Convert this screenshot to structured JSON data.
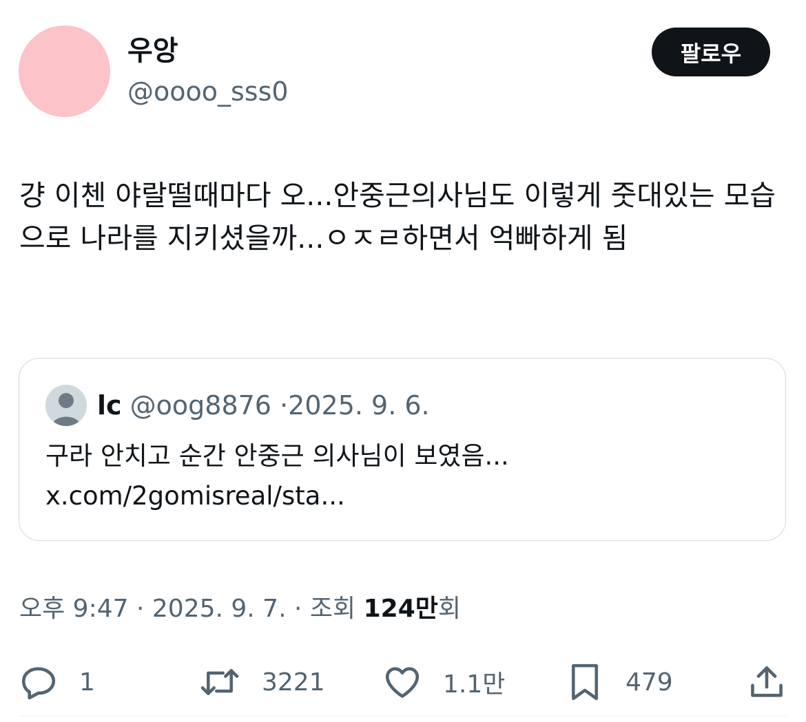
{
  "author": {
    "name": "우앙",
    "handle": "@oooo_sss0",
    "avatar_color": "#fcc3c8"
  },
  "follow_label": "팔로우",
  "tweet": {
    "text": "걍 이첸 야랄떨때마다 오...안중근의사님도 이렇게 줏대있는 모습으로 나라를 지키셨을까...ㅇㅈㄹ하면서 억빠하게 됨"
  },
  "quoted": {
    "name": "lc",
    "handle": "@oog8876",
    "separator": "·",
    "date": "2025. 9. 6.",
    "text": "구라 안치고 순간 안중근 의사님이 보였음... x.com/2gomisreal/sta..."
  },
  "meta": {
    "time": "오후 9:47",
    "sep1": "·",
    "date": "2025. 9. 7.",
    "sep2": "·",
    "views_prefix": "조회",
    "views_value": "124만",
    "views_suffix": "회"
  },
  "actions": {
    "replies": "1",
    "retweets": "3221",
    "likes": "1.1만",
    "bookmarks": "479"
  },
  "icons": [
    "reply-icon",
    "retweet-icon",
    "like-icon",
    "bookmark-icon",
    "share-icon",
    "default-avatar-icon"
  ]
}
